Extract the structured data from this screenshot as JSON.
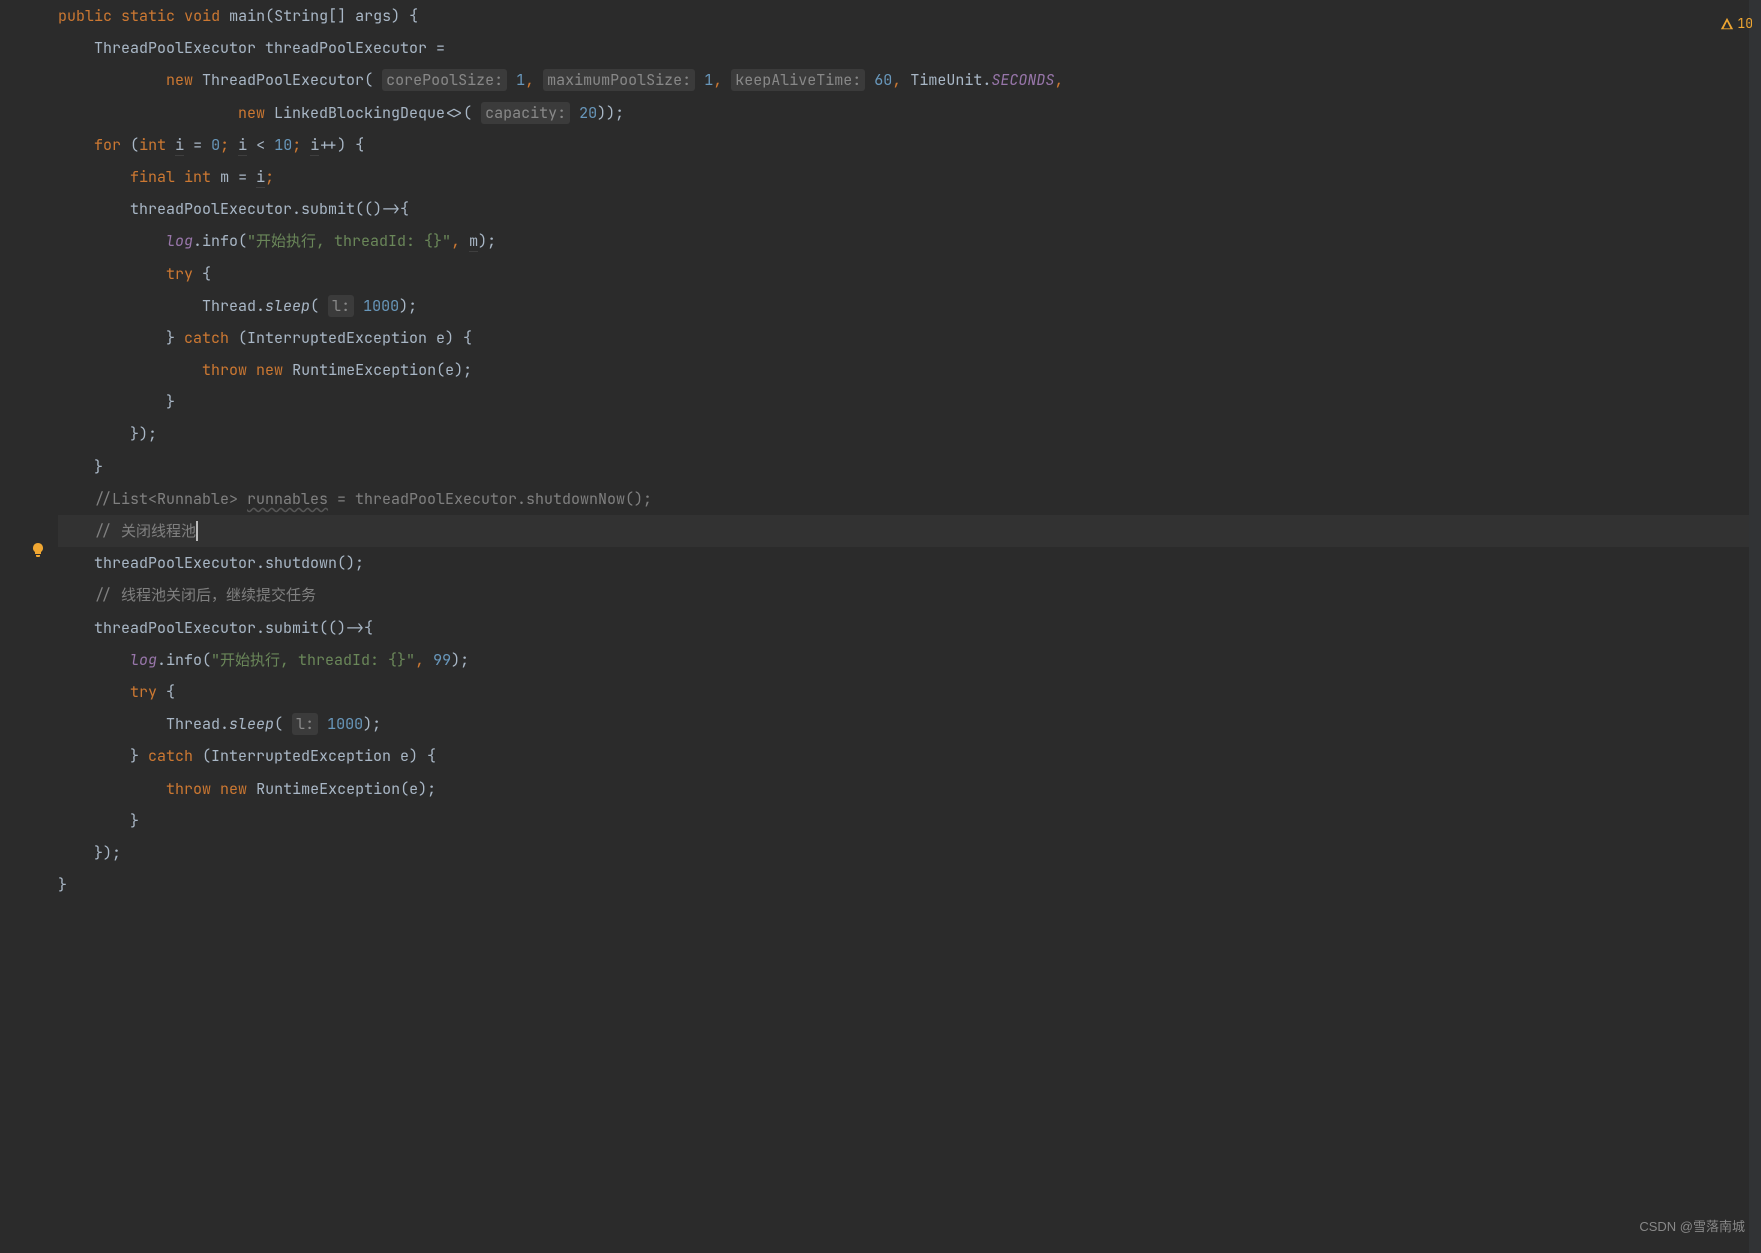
{
  "warn": {
    "count": "10"
  },
  "watermark": "CSDN @雪落南城",
  "code": {
    "l1": {
      "kw1": "public",
      "kw2": "static",
      "kw3": "void",
      "fn": "main",
      "p": "(String[] args) {"
    },
    "l2": {
      "t": "ThreadPoolExecutor threadPoolExecutor ="
    },
    "l3": {
      "kw": "new",
      "cls": "ThreadPoolExecutor",
      "hp1": "corePoolSize:",
      "v1": "1",
      "c1": ",",
      "hp2": "maximumPoolSize:",
      "v2": "1",
      "c2": ",",
      "hp3": "keepAliveTime:",
      "v3": "60",
      "c3": ",",
      "tu": "TimeUnit.",
      "sec": "SECONDS",
      "end": ","
    },
    "l4": {
      "kw": "new",
      "cls": "LinkedBlockingDeque<>(",
      "hp": "capacity:",
      "v": "20",
      "end": "));"
    },
    "l5": {
      "kw": "for",
      "p": "(",
      "kw2": "int",
      "i": "i",
      "eq": " = ",
      "n0": "0",
      "sc": "; ",
      "i2": "i",
      "lt": " < ",
      "n10": "10",
      "sc2": "; ",
      "i3": "i",
      "inc": "++) {"
    },
    "l6": {
      "kw1": "final",
      "kw2": "int",
      "m": "m = ",
      "i": "i",
      "sc": ";"
    },
    "l7": {
      "t": "threadPoolExecutor.submit(()->{"
    },
    "l8": {
      "log": "log",
      "info": ".info(",
      "str": "\"开始执行, threadId: {}\"",
      "c": ", ",
      "m": "m",
      "end": ");"
    },
    "l9": {
      "kw": "try",
      "b": " {"
    },
    "l10": {
      "cls": "Thread.",
      "fn": "sleep",
      "p": "( ",
      "hp": "l:",
      "v": "1000",
      "end": ");"
    },
    "l11": {
      "b": "} ",
      "kw": "catch",
      "p": " (InterruptedException e) {"
    },
    "l12": {
      "kw1": "throw",
      "kw2": "new",
      "cls": "RuntimeException(e);"
    },
    "l13": {
      "b": "}"
    },
    "l14": {
      "b": "});"
    },
    "l15": {
      "b": "}"
    },
    "l16": {
      "c": "//List<Runnable> ",
      "r": "runnables",
      "rest": " = threadPoolExecutor.shutdownNow();"
    },
    "l17": {
      "c": "// 关闭线程池"
    },
    "l18": {
      "t": "threadPoolExecutor.shutdown();"
    },
    "l19": {
      "c": "// 线程池关闭后，继续提交任务"
    },
    "l20": {
      "t": "threadPoolExecutor.submit(()->{"
    },
    "l21": {
      "log": "log",
      "info": ".info(",
      "str": "\"开始执行, threadId: {}\"",
      "c": ", ",
      "v": "99",
      "end": ");"
    },
    "l22": {
      "kw": "try",
      "b": " {"
    },
    "l23": {
      "cls": "Thread.",
      "fn": "sleep",
      "p": "( ",
      "hp": "l:",
      "v": "1000",
      "end": ");"
    },
    "l24": {
      "b": "} ",
      "kw": "catch",
      "p": " (InterruptedException e) {"
    },
    "l25": {
      "kw1": "throw",
      "kw2": "new",
      "cls": "RuntimeException(e);"
    },
    "l26": {
      "b": "}"
    },
    "l27": {
      "b": "});"
    },
    "l28": {
      "b": "}"
    }
  }
}
